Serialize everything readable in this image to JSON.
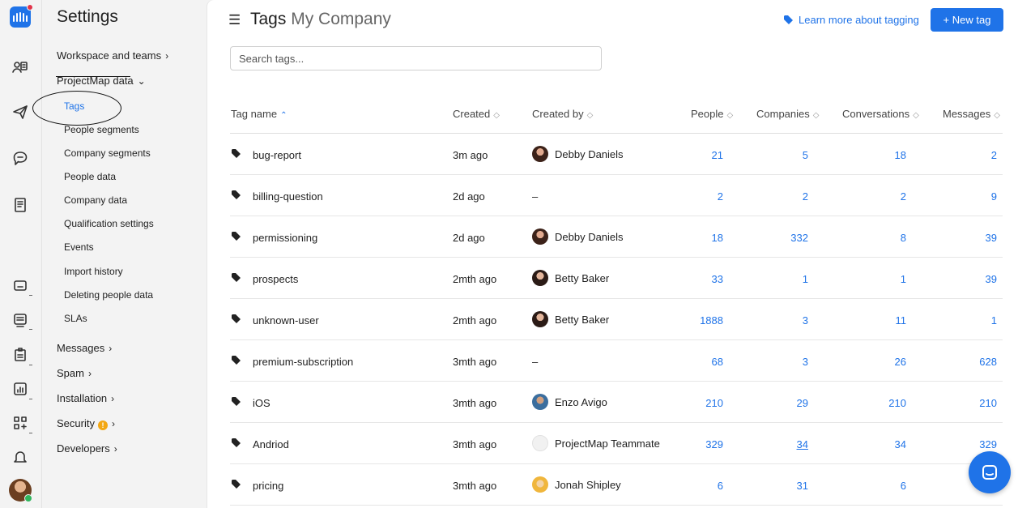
{
  "sidebar": {
    "title": "Settings",
    "sections": {
      "workspace": "Workspace and teams",
      "projectmap": "ProjectMap data",
      "messages": "Messages",
      "spam": "Spam",
      "installation": "Installation",
      "security": "Security",
      "developers": "Developers"
    },
    "sub_items": [
      "Tags",
      "People segments",
      "Company segments",
      "People data",
      "Company data",
      "Qualification settings",
      "Events",
      "Import history",
      "Deleting people data",
      "SLAs"
    ]
  },
  "header": {
    "title": "Tags",
    "company": "My Company",
    "learn_more": "Learn more about tagging",
    "new_tag": "+ New tag"
  },
  "search": {
    "placeholder": "Search tags..."
  },
  "columns": {
    "tag_name": "Tag name",
    "created": "Created",
    "created_by": "Created by",
    "people": "People",
    "companies": "Companies",
    "conversations": "Conversations",
    "messages": "Messages"
  },
  "rows": [
    {
      "name": "bug-report",
      "created": "3m ago",
      "by": "Debby Daniels",
      "people": "21",
      "companies": "5",
      "conversations": "18",
      "messages": "2"
    },
    {
      "name": "billing-question",
      "created": "2d ago",
      "by": "–",
      "people": "2",
      "companies": "2",
      "conversations": "2",
      "messages": "9"
    },
    {
      "name": "permissioning",
      "created": "2d ago",
      "by": "Debby Daniels",
      "people": "18",
      "companies": "332",
      "conversations": "8",
      "messages": "39"
    },
    {
      "name": "prospects",
      "created": "2mth ago",
      "by": "Betty Baker",
      "people": "33",
      "companies": "1",
      "conversations": "1",
      "messages": "39"
    },
    {
      "name": "unknown-user",
      "created": "2mth ago",
      "by": "Betty Baker",
      "people": "1888",
      "companies": "3",
      "conversations": "11",
      "messages": "1"
    },
    {
      "name": "premium-subscription",
      "created": "3mth ago",
      "by": "–",
      "people": "68",
      "companies": "3",
      "conversations": "26",
      "messages": "628"
    },
    {
      "name": "iOS",
      "created": "3mth ago",
      "by": "Enzo Avigo",
      "people": "210",
      "companies": "29",
      "conversations": "210",
      "messages": "210"
    },
    {
      "name": "Andriod",
      "created": "3mth ago",
      "by": "ProjectMap Teammate",
      "people": "329",
      "companies": "34",
      "conversations": "34",
      "messages": "329"
    },
    {
      "name": "pricing",
      "created": "3mth ago",
      "by": "Jonah Shipley",
      "people": "6",
      "companies": "31",
      "conversations": "6",
      "messages": ""
    }
  ],
  "colors": {
    "accent": "#1f73e8",
    "warning": "#f3a712",
    "badge": "#e2344a"
  }
}
